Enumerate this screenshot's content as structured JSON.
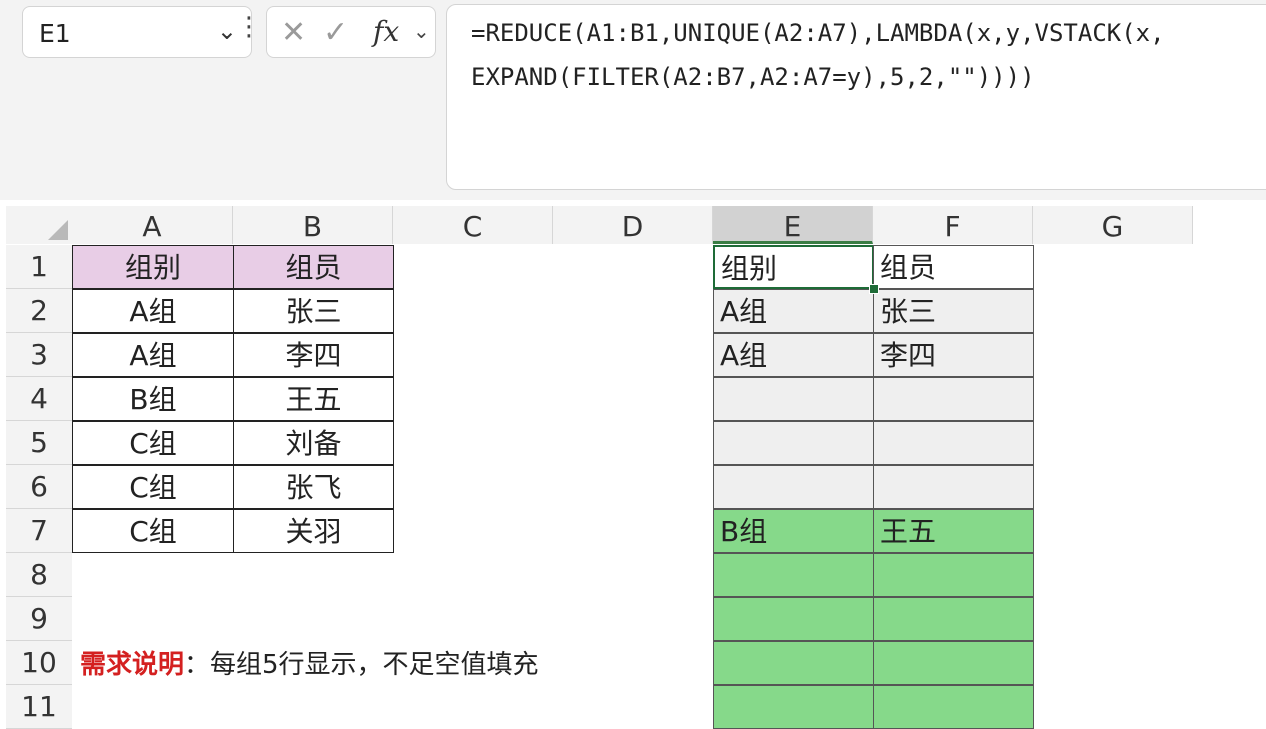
{
  "name_box": {
    "ref": "E1"
  },
  "formula_bar": {
    "line1": "=REDUCE(A1:B1,UNIQUE(A2:A7),LAMBDA(x,y,VSTACK(x,",
    "line2": "EXPAND(FILTER(A2:B7,A2:A7=y),5,2,\"\"))))"
  },
  "columns": [
    "A",
    "B",
    "C",
    "D",
    "E",
    "F",
    "G"
  ],
  "rows": [
    "1",
    "2",
    "3",
    "4",
    "5",
    "6",
    "7",
    "8",
    "9",
    "10",
    "11"
  ],
  "source_table": [
    [
      "组别",
      "组员"
    ],
    [
      "A组",
      "张三"
    ],
    [
      "A组",
      "李四"
    ],
    [
      "B组",
      "王五"
    ],
    [
      "C组",
      "刘备"
    ],
    [
      "C组",
      "张飞"
    ],
    [
      "C组",
      "关羽"
    ]
  ],
  "result_table": [
    [
      "组别",
      "组员"
    ],
    [
      "A组",
      "张三"
    ],
    [
      "A组",
      "李四"
    ],
    [
      "",
      ""
    ],
    [
      "",
      ""
    ],
    [
      "",
      ""
    ],
    [
      "B组",
      "王五"
    ],
    [
      "",
      ""
    ],
    [
      "",
      ""
    ],
    [
      "",
      ""
    ],
    [
      "",
      ""
    ]
  ],
  "note": {
    "label": "需求说明",
    "text": "：每组5行显示，不足空值填充"
  },
  "colors": {
    "header_fill": "#e8cde6",
    "group_b_fill": "#86d98a",
    "active_border": "#1e6b37"
  }
}
